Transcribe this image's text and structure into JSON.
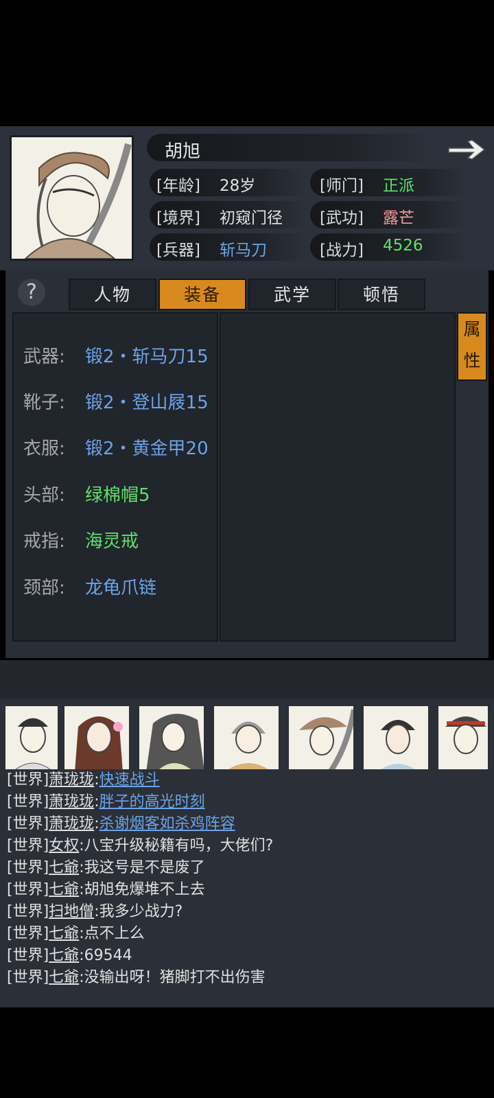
{
  "character": {
    "name": "胡旭",
    "stats": [
      {
        "label": "[年龄]",
        "value": "28岁",
        "color": "#e2e2e2"
      },
      {
        "label": "[师门]",
        "value": "正派",
        "color": "#5fe16b"
      },
      {
        "label": "[境界]",
        "value": "初窥门径",
        "color": "#e2e2e2"
      },
      {
        "label": "[武功]",
        "value": "露芒",
        "color": "#f59c9c"
      },
      {
        "label": "[兵器]",
        "value": "斩马刀",
        "color": "#6ca4e8"
      },
      {
        "label": "[战力]",
        "value": "4526",
        "color": "#5fe16b"
      }
    ]
  },
  "tabs": [
    {
      "label": "人物",
      "active": false
    },
    {
      "label": "装备",
      "active": true
    },
    {
      "label": "武学",
      "active": false
    },
    {
      "label": "顿悟",
      "active": false
    }
  ],
  "help_icon": "?",
  "attr_button": {
    "line1": "属",
    "line2": "性"
  },
  "equipment": [
    {
      "slot": "武器:",
      "item": "锻2・斩马刀15",
      "color": "#6ca4e8"
    },
    {
      "slot": "靴子:",
      "item": "锻2・登山屐15",
      "color": "#6ca4e8"
    },
    {
      "slot": "衣服:",
      "item": "锻2・黄金甲20",
      "color": "#6ca4e8"
    },
    {
      "slot": "头部:",
      "item": "绿棉帽5",
      "color": "#5fe16b"
    },
    {
      "slot": "戒指:",
      "item": "海灵戒",
      "color": "#5fe16b"
    },
    {
      "slot": "颈部:",
      "item": "龙龟爪链",
      "color": "#6ca4e8"
    }
  ],
  "chat": [
    {
      "channel": "[世界]",
      "user": "萧珑珑",
      "msg": "快速战斗",
      "link": true
    },
    {
      "channel": "[世界]",
      "user": "萧珑珑",
      "msg": "胖子的高光时刻",
      "link": true
    },
    {
      "channel": "[世界]",
      "user": "萧珑珑",
      "msg": "杀谢烟客如杀鸡阵容",
      "link": true
    },
    {
      "channel": "[世界]",
      "user": "女权",
      "msg": "八宝升级秘籍有吗，大佬们?",
      "link": false
    },
    {
      "channel": "[世界]",
      "user": "七爺",
      "msg": "我这号是不是废了",
      "link": false
    },
    {
      "channel": "[世界]",
      "user": "七爺",
      "msg": "胡旭免爆堆不上去",
      "link": false
    },
    {
      "channel": "[世界]",
      "user": "扫地僧",
      "msg": "我多少战力?",
      "link": false
    },
    {
      "channel": "[世界]",
      "user": "七爺",
      "msg": "点不上么",
      "link": false
    },
    {
      "channel": "[世界]",
      "user": "七爺",
      "msg": "69544",
      "link": false
    },
    {
      "channel": "[世界]",
      "user": "七爺",
      "msg": "没输出呀！猪脚打不出伤害",
      "link": false
    }
  ],
  "icons": {
    "portrait": "hero-portrait-icon",
    "next": "arrow-right-icon",
    "avatars": [
      "avatar-1",
      "avatar-2",
      "avatar-3",
      "avatar-4",
      "avatar-5",
      "avatar-6",
      "avatar-7"
    ]
  }
}
